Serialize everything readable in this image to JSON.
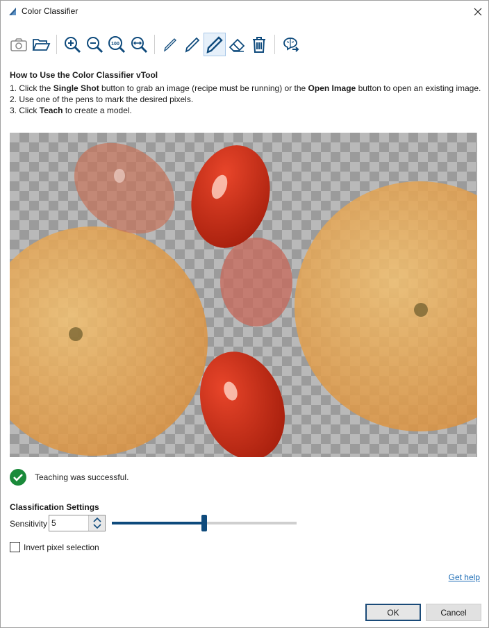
{
  "window": {
    "title": "Color Classifier",
    "close_label": "✕"
  },
  "toolbar": {
    "items": [
      "camera-icon",
      "folder-open-icon",
      "zoom-in-icon",
      "zoom-out-icon",
      "zoom-100-icon",
      "zoom-fit-icon",
      "pen-thin-icon",
      "pen-medium-icon",
      "pen-thick-icon",
      "eraser-icon",
      "trash-icon",
      "teach-icon"
    ],
    "zoom_100_text": "100",
    "active_item": "pen-thick-icon"
  },
  "howto": {
    "title": "How to Use the Color Classifier vTool",
    "step1": {
      "a": "1. Click the ",
      "b1": "Single Shot",
      "c": " button to grab an image (recipe must be running) or the ",
      "b2": "Open Image",
      "d": " button to open an existing image."
    },
    "step2": "2. Use one of the pens to mark the desired pixels.",
    "step3": {
      "a": "3. Click ",
      "b": "Teach",
      "c": " to create a model."
    }
  },
  "status": {
    "text": "Teaching was successful.",
    "color": "#1a8a3a"
  },
  "settings": {
    "title": "Classification Settings",
    "sensitivity_label": "Sensitivity",
    "sensitivity_value": "5",
    "slider_fraction": 0.5,
    "invert_label": "Invert pixel selection",
    "invert_checked": false
  },
  "help_link": "Get help",
  "buttons": {
    "ok": "OK",
    "cancel": "Cancel"
  },
  "colors": {
    "accent": "#0e4a7c",
    "link": "#1b6bb5"
  }
}
